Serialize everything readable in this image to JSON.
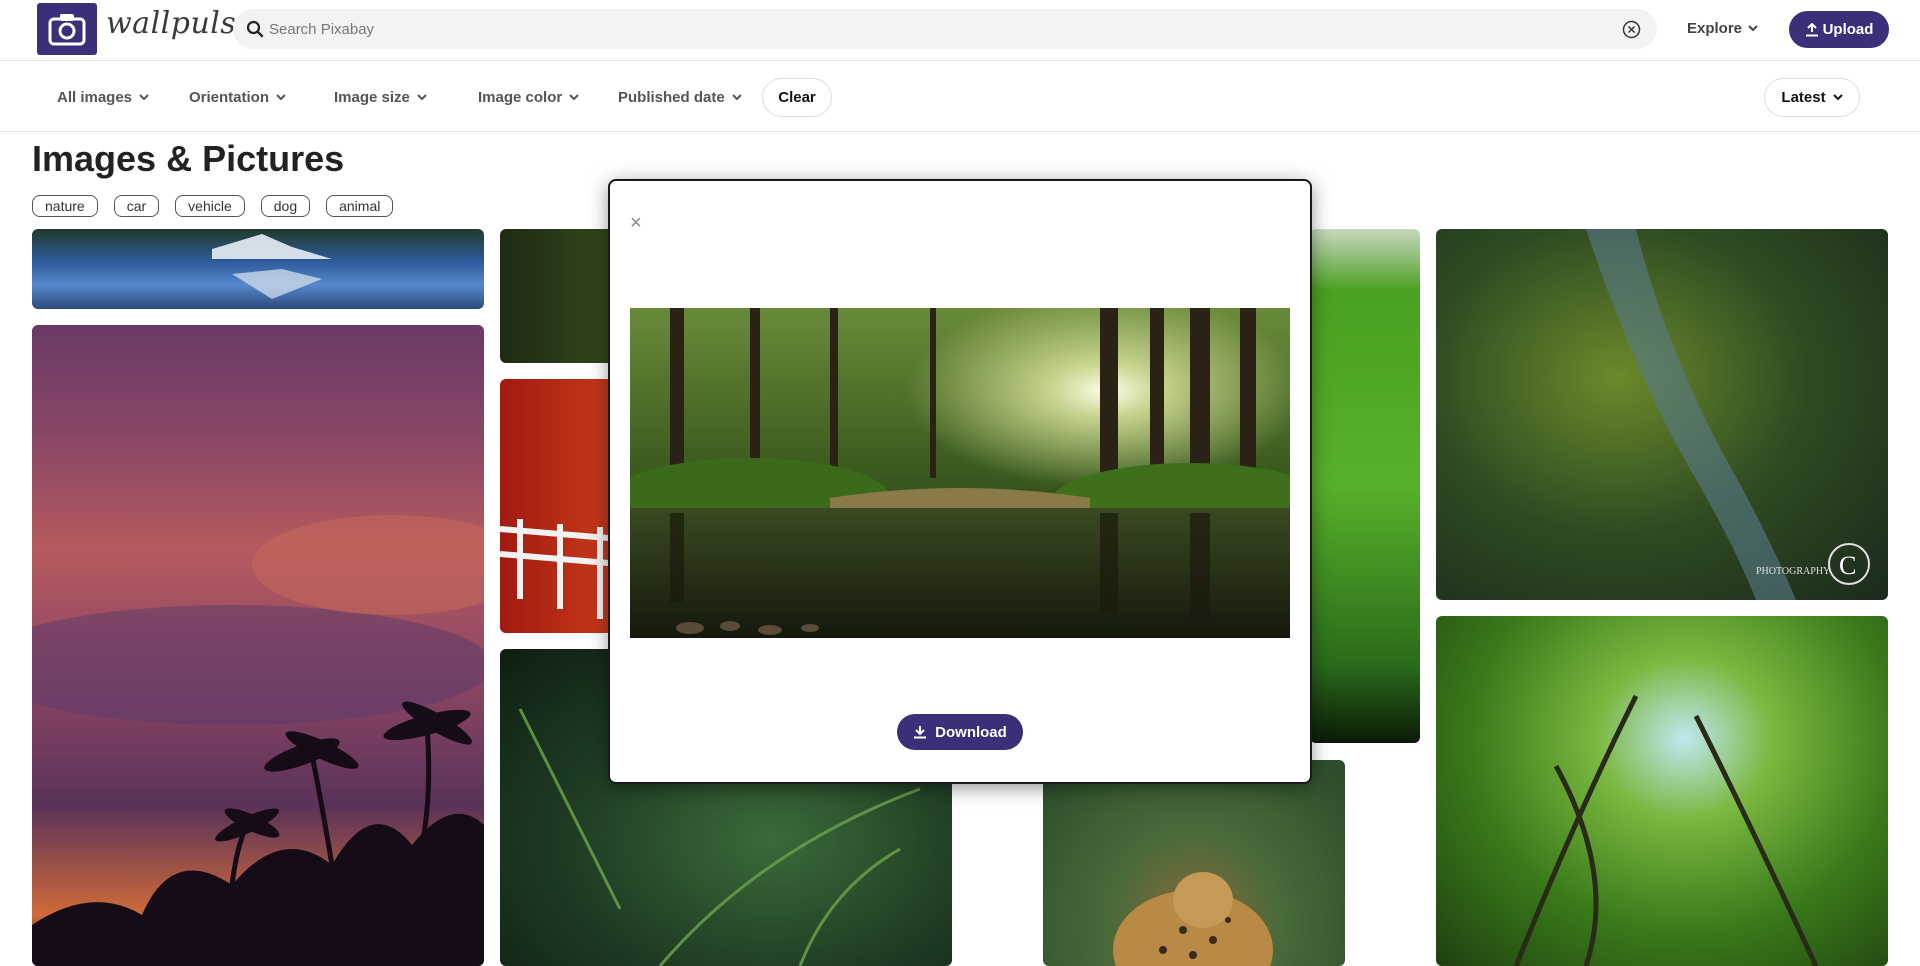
{
  "header": {
    "logo_text": "wallpulse",
    "search_placeholder": "Search Pixabay",
    "explore_label": "Explore",
    "upload_label": "Upload"
  },
  "filters": {
    "items": [
      "All images",
      "Orientation",
      "Image size",
      "Image color",
      "Published date"
    ],
    "clear_label": "Clear",
    "sort_label": "Latest"
  },
  "page": {
    "title": "Images & Pictures",
    "tags": [
      "nature",
      "car",
      "vehicle",
      "dog",
      "animal"
    ]
  },
  "modal": {
    "close_label": "×",
    "download_label": "Download"
  },
  "watermark": {
    "text": "PHOTOGRAPHY",
    "letter": "C"
  },
  "colors": {
    "brand": "#3b2f7a"
  }
}
